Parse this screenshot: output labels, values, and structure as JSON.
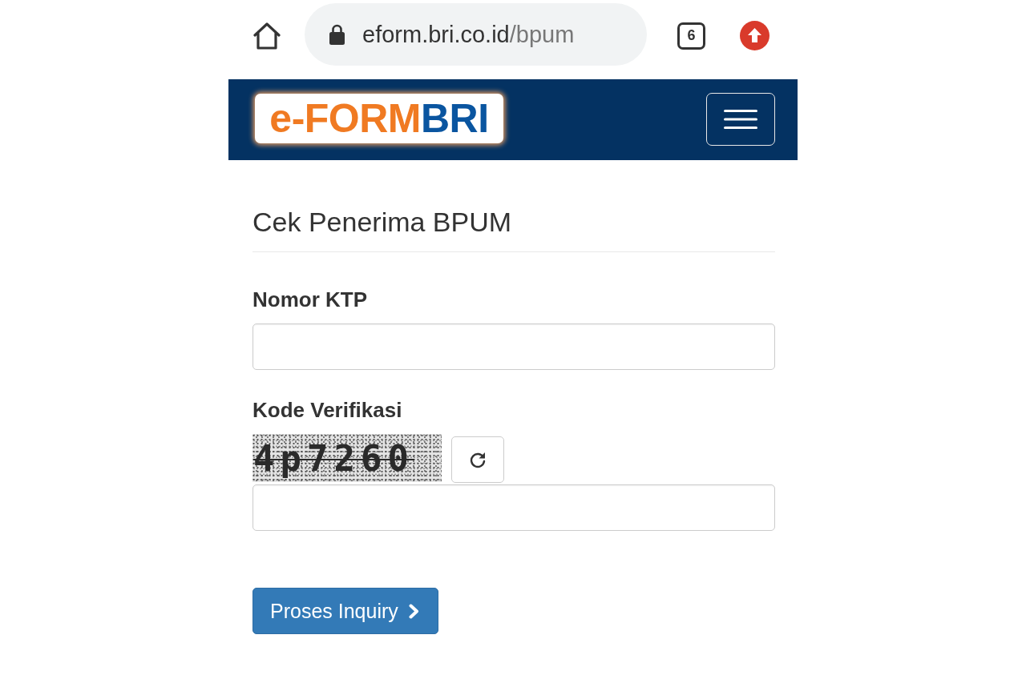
{
  "browser_bar": {
    "url": {
      "host": "eform.bri.co.id",
      "path": "/bpum"
    },
    "tab_count": "6"
  },
  "navbar": {
    "logo": {
      "main": "e-FORM",
      "accent": "BRI"
    }
  },
  "form": {
    "title": "Cek Penerima BPUM",
    "fields": [
      {
        "kind": "text",
        "label": "Nomor KTP"
      },
      {
        "kind": "captcha",
        "label": "Kode Verifikasi",
        "captcha_text": "4p7260"
      }
    ],
    "submit": {
      "label": "Proses Inquiry"
    }
  }
}
